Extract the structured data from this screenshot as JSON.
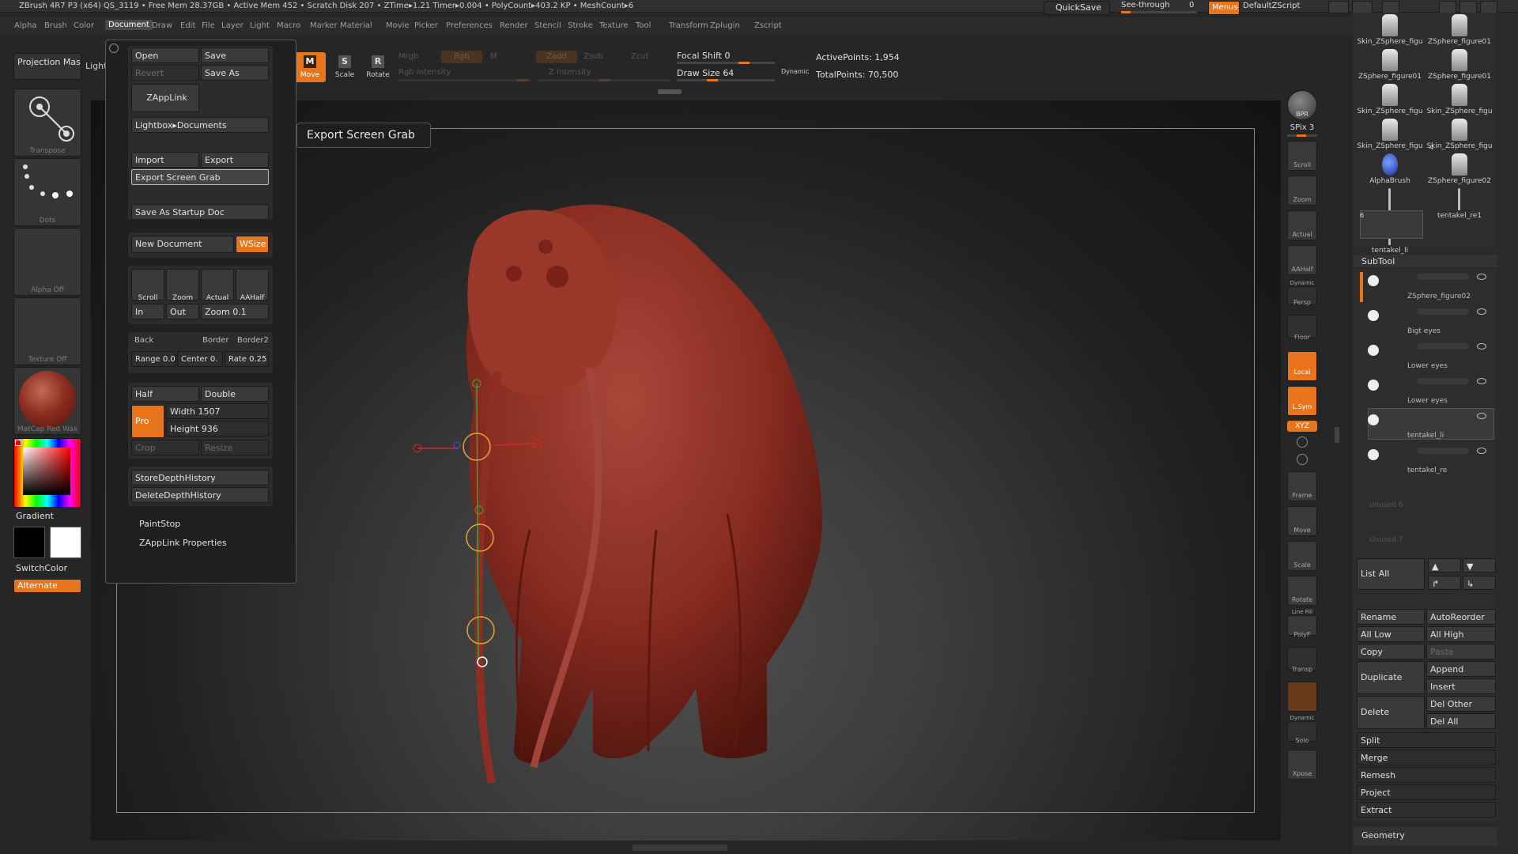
{
  "titlebar": {
    "text": "ZBrush 4R7 P3 (x64)   QS_3119   • Free Mem 28.37GB • Active Mem 452 • Scratch Disk 207 •  ZTime▸1.21  Timer▸0.004 • PolyCount▸403.2 KP  • MeshCount▸6",
    "quicksave": "QuickSave",
    "seethrough": "See-through",
    "seethrough_value": "0",
    "menus": "Menus",
    "script": "DefaultZScript"
  },
  "menubar": [
    "Alpha",
    "Brush",
    "Color",
    "Document",
    "Draw",
    "Edit",
    "File",
    "Layer",
    "Light",
    "Macro",
    "Marker",
    "Material",
    "Movie",
    "Picker",
    "Preferences",
    "Render",
    "Stencil",
    "Stroke",
    "Texture",
    "Tool",
    "Transform",
    "Zplugin",
    "Zscript"
  ],
  "menubar_active": "Document",
  "toolbar": {
    "projection_master": "Projection Master",
    "lightbox": "LightBox",
    "move": "Move",
    "scale": "Scale",
    "rotate": "Rotate",
    "mrgb": "Mrgb",
    "rgb": "Rgb",
    "m": "M",
    "rgb_intensity": "Rgb Intensity",
    "zadd": "Zadd",
    "zsub": "Zsub",
    "zcut": "Zcut",
    "z_intensity": "Z Intensity",
    "focal_shift": "Focal Shift",
    "focal_shift_value": "0",
    "draw_size": "Draw Size",
    "draw_size_value": "64",
    "dynamic": "Dynamic",
    "active_points": "ActivePoints: 1,954",
    "total_points": "TotalPoints: 70,500"
  },
  "left_shelf": {
    "transpose": "Transpose",
    "dots": "Dots",
    "alpha_off": "Alpha Off",
    "texture_off": "Texture Off",
    "matcap": "MatCap Red Wax",
    "gradient": "Gradient",
    "switchcolor": "SwitchColor",
    "alternate": "Alternate"
  },
  "document_menu": {
    "open": "Open",
    "save": "Save",
    "revert": "Revert",
    "save_as": "Save As",
    "zapplink": "ZAppLink",
    "lightbox_documents": "Lightbox▸Documents",
    "import": "Import",
    "export": "Export",
    "export_screen_grab": "Export Screen Grab",
    "save_as_startup_doc": "Save As Startup Doc",
    "new_document": "New Document",
    "wsize": "WSize",
    "scroll": "Scroll",
    "zoom": "Zoom",
    "actual": "Actual",
    "aahalf": "AAHalf",
    "in": "In",
    "out": "Out",
    "zoom_value": "Zoom 0.1",
    "back": "Back",
    "border": "Border",
    "border2": "Border2",
    "range": "Range 0.0",
    "center": "Center 0.",
    "rate": "Rate 0.25",
    "half": "Half",
    "double": "Double",
    "pro": "Pro",
    "width": "Width 1507",
    "height": "Height 936",
    "crop": "Crop",
    "resize": "Resize",
    "store_depth": "StoreDepthHistory",
    "delete_depth": "DeleteDepthHistory",
    "paintstop": "PaintStop",
    "zapplink_props": "ZAppLink Properties"
  },
  "tooltip": "Export Screen Grab",
  "right_strip": {
    "bpr": "BPR",
    "spix": "SPix 3",
    "scroll": "Scroll",
    "zoom": "Zoom",
    "actual": "Actual",
    "aahalf": "AAHalf",
    "dynamic": "Dynamic",
    "persp": "Persp",
    "floor": "Floor",
    "local": "Local",
    "lsym": "L.Sym",
    "xyz": "XYZ",
    "frame": "Frame",
    "move": "Move",
    "scale": "Scale",
    "rotate": "Rotate",
    "linefill": "Line Fill",
    "polyf": "PolyF",
    "transp": "Transp",
    "dynamic2": "Dynamic",
    "solo": "Solo",
    "xpose": "Xpose"
  },
  "tool_palette": [
    {
      "name": "Skin_ZSphere_figu"
    },
    {
      "name": "ZSphere_figure01"
    },
    {
      "name": "ZSphere_figure01"
    },
    {
      "name": "ZSphere_figure01"
    },
    {
      "name": "Skin_ZSphere_figu"
    },
    {
      "name": "Skin_ZSphere_figu"
    },
    {
      "name": "Skin_ZSphere_figu"
    },
    {
      "name": "Skin_ZSphere_figu"
    },
    {
      "name": "AlphaBrush"
    },
    {
      "name": "ZSphere_figure02"
    },
    {
      "name": "tentakel_li1"
    },
    {
      "name": "tentakel_re1"
    },
    {
      "name": "tentakel_li"
    }
  ],
  "tool_palette_badges": {
    "four": "4",
    "six": "6"
  },
  "subtool": {
    "title": "SubTool",
    "items": [
      "ZSphere_figure02",
      "Bigt eyes",
      "Lower eyes",
      "Lower eyes",
      "tentakel_li",
      "tentakel_re",
      "Unused 6",
      "Unused 7"
    ],
    "list_all": "List All",
    "rename": "Rename",
    "autoreorder": "AutoReorder",
    "all_low": "All Low",
    "all_high": "All High",
    "copy": "Copy",
    "paste": "Paste",
    "duplicate": "Duplicate",
    "append": "Append",
    "insert": "Insert",
    "delete": "Delete",
    "del_other": "Del Other",
    "del_all": "Del All",
    "split": "Split",
    "merge": "Merge",
    "remesh": "Remesh",
    "project": "Project",
    "extract": "Extract",
    "geometry": "Geometry"
  },
  "colors": {
    "accent": "#e8741c",
    "model": "#8e2e22",
    "bg": "#262626"
  }
}
